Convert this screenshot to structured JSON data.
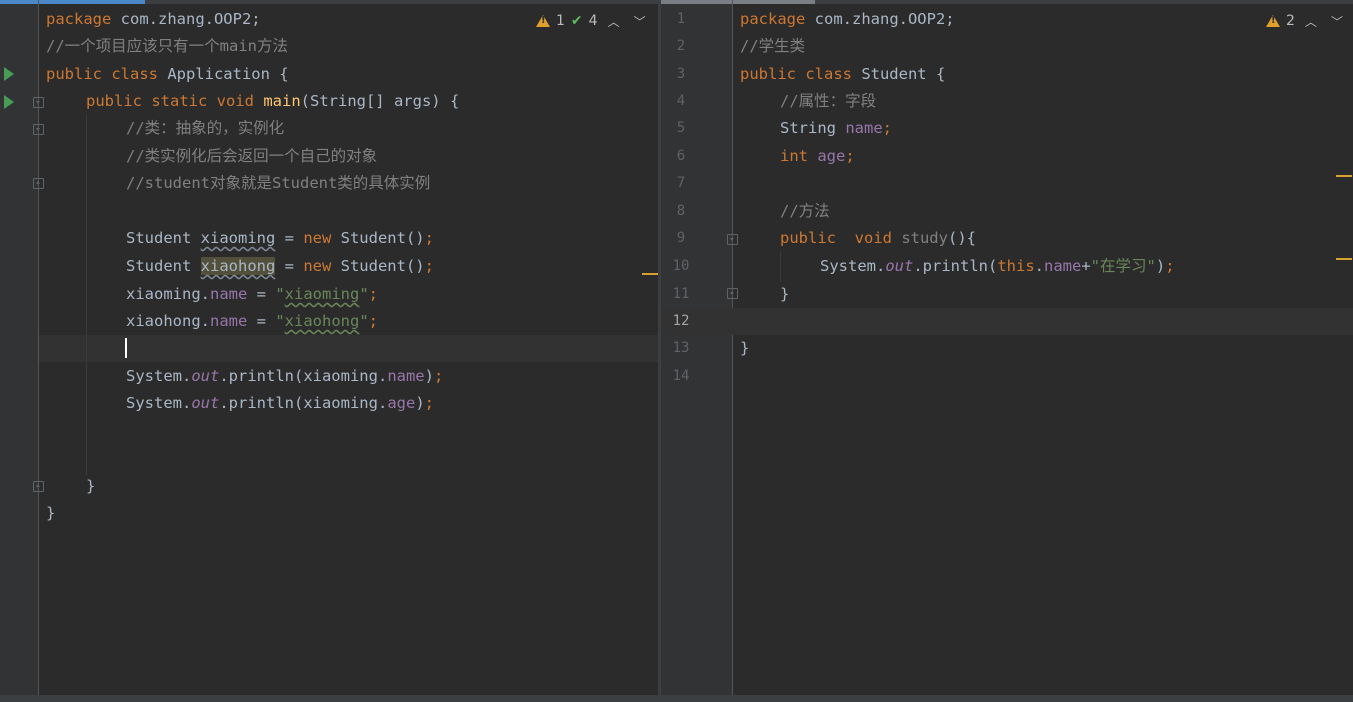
{
  "left_editor": {
    "inspections": {
      "warnings": "1",
      "typos": "4"
    },
    "lines": {
      "l1_kw": "package",
      "l1_rest": " com.zhang.OOP2;",
      "l2": "//一个项目应该只有一个main方法",
      "l3_kw": "public class",
      "l3_rest": " Application {",
      "l4_kw": "public static void",
      "l4_fn": "main",
      "l4_rest": "(String[] args) {",
      "l5": "//类：抽象的，实例化",
      "l6": "//类实例化后会返回一个自己的对象",
      "l7": "//student对象就是Student类的具体实例",
      "l9_type": "Student ",
      "l9_var": "xiaoming",
      "l9_eq": " = ",
      "l9_new": "new",
      "l9_rest": " Student()",
      "l9_semi": ";",
      "l10_type": "Student ",
      "l10_var": "xiaohong",
      "l10_eq": " = ",
      "l10_new": "new",
      "l10_rest": " Student()",
      "l10_semi": ";",
      "l11_obj": "xiaoming.",
      "l11_field": "name",
      "l11_eq": " = ",
      "l11_q1": "\"",
      "l11_str": "xiaoming",
      "l11_q2": "\"",
      "l11_semi": ";",
      "l12_obj": "xiaohong.",
      "l12_field": "name",
      "l12_eq": " = ",
      "l12_q1": "\"",
      "l12_str": "xiaohong",
      "l12_q2": "\"",
      "l12_semi": ";",
      "l14_a": "System.",
      "l14_out": "out",
      "l14_b": ".println(xiaoming.",
      "l14_field": "name",
      "l14_c": ")",
      "l14_semi": ";",
      "l15_a": "System.",
      "l15_out": "out",
      "l15_b": ".println(xiaoming.",
      "l15_field": "age",
      "l15_c": ")",
      "l15_semi": ";",
      "l18": "}",
      "l19": "}"
    }
  },
  "right_editor": {
    "inspections": {
      "warnings": "2"
    },
    "line_numbers": [
      "1",
      "2",
      "3",
      "4",
      "5",
      "6",
      "7",
      "8",
      "9",
      "10",
      "11",
      "12",
      "13",
      "14"
    ],
    "current_line": "12",
    "lines": {
      "l1_kw": "package",
      "l1_rest": " com.zhang.OOP2;",
      "l2": "//学生类",
      "l3_kw": "public class",
      "l3_rest": " Student {",
      "l4": "//属性：字段",
      "l5_type": "String ",
      "l5_field": "name",
      "l5_semi": ";",
      "l6_kw": "int",
      "l6_field": " age",
      "l6_semi": ";",
      "l8": "//方法",
      "l9_kw": "public  void",
      "l9_fn": " study",
      "l9_rest": "(){",
      "l10_a": "System.",
      "l10_out": "out",
      "l10_b": ".println(",
      "l10_this": "this",
      "l10_c": ".",
      "l10_field": "name",
      "l10_d": "+",
      "l10_str": "\"在学习\"",
      "l10_e": ")",
      "l10_semi": ";",
      "l11": "}",
      "l13": "}"
    }
  }
}
